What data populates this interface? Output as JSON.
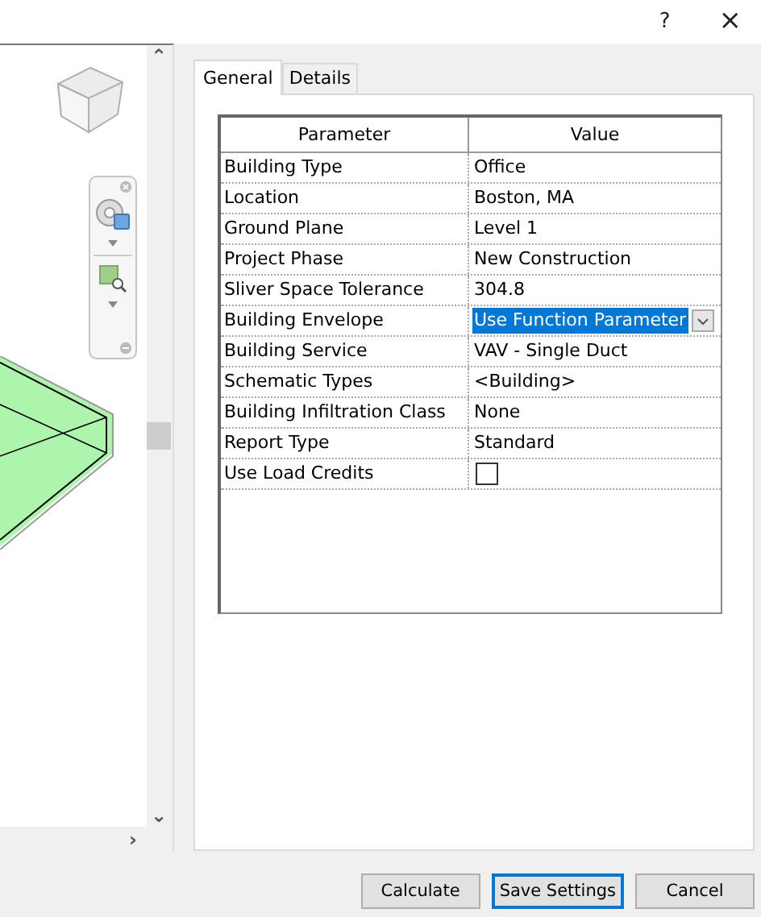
{
  "title_bar": {
    "help": "?",
    "close": "×"
  },
  "viewport": {
    "scroll_up": "⌃",
    "scroll_down": "⌄",
    "scroll_right": "›"
  },
  "tabs": [
    {
      "label": "General",
      "selected": true
    },
    {
      "label": "Details",
      "selected": false
    }
  ],
  "table": {
    "columns": [
      "Parameter",
      "Value"
    ],
    "rows": [
      {
        "parameter": "Building Type",
        "kind": "text",
        "value": "Office",
        "selected": false
      },
      {
        "parameter": "Location",
        "kind": "text",
        "value": "Boston, MA",
        "selected": false
      },
      {
        "parameter": "Ground Plane",
        "kind": "text",
        "value": "Level 1",
        "selected": false
      },
      {
        "parameter": "Project Phase",
        "kind": "text",
        "value": "New Construction",
        "selected": false
      },
      {
        "parameter": "Sliver Space Tolerance",
        "kind": "text",
        "value": "304.8",
        "selected": false
      },
      {
        "parameter": "Building Envelope",
        "kind": "dropdown",
        "value": "Use Function Parameter",
        "selected": true
      },
      {
        "parameter": "Building Service",
        "kind": "text",
        "value": "VAV - Single Duct",
        "selected": false
      },
      {
        "parameter": "Schematic Types",
        "kind": "text",
        "value": "<Building>",
        "selected": false
      },
      {
        "parameter": "Building Infiltration Class",
        "kind": "text",
        "value": "None",
        "selected": false
      },
      {
        "parameter": "Report Type",
        "kind": "text",
        "value": "Standard",
        "selected": false
      },
      {
        "parameter": "Use Load Credits",
        "kind": "checkbox",
        "checked": false,
        "selected": false
      }
    ]
  },
  "buttons": [
    {
      "label": "Calculate",
      "default": false
    },
    {
      "label": "Save Settings",
      "default": true
    },
    {
      "label": "Cancel",
      "default": false
    }
  ]
}
